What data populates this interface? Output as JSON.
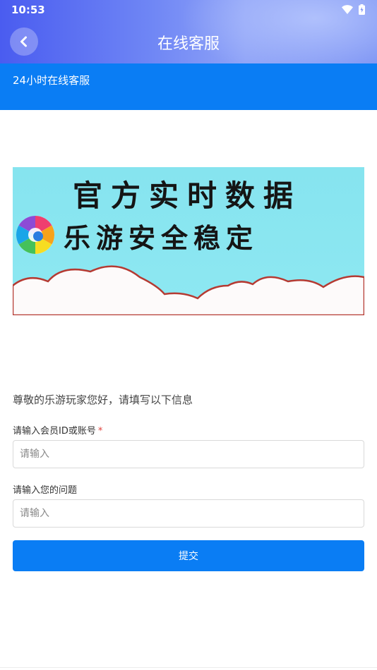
{
  "status_bar": {
    "time": "10:53"
  },
  "header": {
    "title": "在线客服",
    "back_icon": "chevron-left-icon"
  },
  "band": {
    "title": "24小时在线客服"
  },
  "banner": {
    "line1": "官方实时数据",
    "line2": "乐游安全稳定",
    "sky_color": "#84e6f0",
    "cloud_outline_color": "#b53a32"
  },
  "form": {
    "greeting": "尊敬的乐游玩家您好，请填写以下信息",
    "member_label": "请输入会员ID或账号",
    "required_mark": "*",
    "member_placeholder": "请输入",
    "question_label": "请输入您的问题",
    "question_placeholder": "请输入",
    "submit_label": "提交"
  },
  "colors": {
    "accent": "#0a7df4",
    "required": "#e0403b"
  }
}
